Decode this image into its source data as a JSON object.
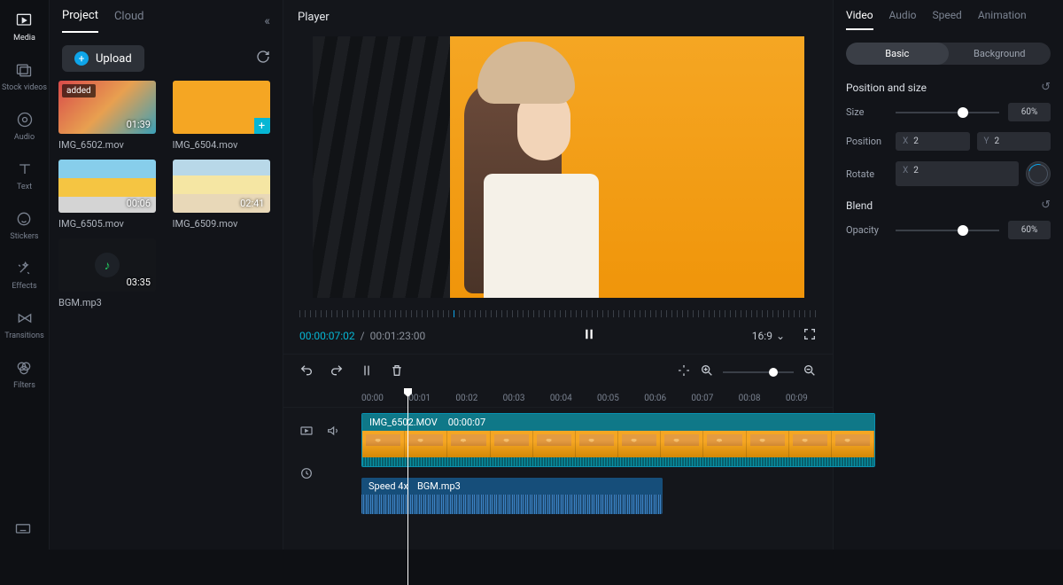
{
  "sidebar": {
    "items": [
      {
        "label": "Media"
      },
      {
        "label": "Stock videos"
      },
      {
        "label": "Audio"
      },
      {
        "label": "Text"
      },
      {
        "label": "Stickers"
      },
      {
        "label": "Effects"
      },
      {
        "label": "Transitions"
      },
      {
        "label": "Filters"
      }
    ]
  },
  "project": {
    "tabs": {
      "project": "Project",
      "cloud": "Cloud"
    },
    "upload_label": "Upload",
    "media": [
      {
        "name": "IMG_6502.mov",
        "duration": "01:39",
        "badge": "added"
      },
      {
        "name": "IMG_6504.mov",
        "duration": ""
      },
      {
        "name": "IMG_6505.mov",
        "duration": "00:06"
      },
      {
        "name": "IMG_6509.mov",
        "duration": "02:41"
      },
      {
        "name": "BGM.mp3",
        "duration": "03:35"
      }
    ]
  },
  "player": {
    "title": "Player",
    "current_time": "00:00:07:02",
    "separator": "/",
    "total_time": "00:01:23:00",
    "aspect": "16:9"
  },
  "timeline": {
    "ticks": [
      "00:00",
      "00:01",
      "00:02",
      "00:03",
      "00:04",
      "00:05",
      "00:06",
      "00:07",
      "00:08",
      "00:09"
    ],
    "video_clip": {
      "name": "IMG_6502.MOV",
      "time": "00:00:07"
    },
    "audio_clip": {
      "speed": "Speed 4x",
      "name": "BGM.mp3"
    }
  },
  "props": {
    "tabs": {
      "video": "Video",
      "audio": "Audio",
      "speed": "Speed",
      "animation": "Animation"
    },
    "seg": {
      "basic": "Basic",
      "background": "Background"
    },
    "sections": {
      "position_size": "Position and size",
      "blend": "Blend"
    },
    "labels": {
      "size": "Size",
      "position": "Position",
      "rotate": "Rotate",
      "opacity": "Opacity"
    },
    "size_value": "60%",
    "position_x_label": "X",
    "position_x": "2",
    "position_y_label": "Y",
    "position_y": "2",
    "rotate_x_label": "X",
    "rotate_x": "2",
    "opacity_value": "60%"
  }
}
